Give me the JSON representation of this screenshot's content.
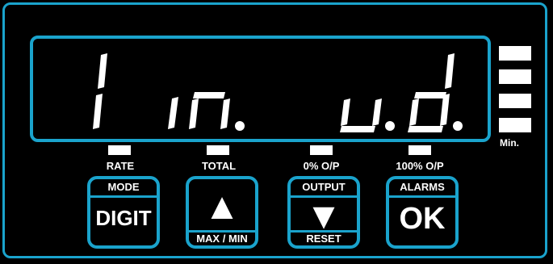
{
  "display": {
    "text": "1 in. u.d.",
    "level_bars": 4,
    "level_label": "Min."
  },
  "indicators": [
    {
      "label": "RATE"
    },
    {
      "label": "TOTAL"
    },
    {
      "label": "0% O/P"
    },
    {
      "label": "100% O/P"
    }
  ],
  "keys": {
    "mode": {
      "top": "MODE",
      "main": "DIGIT"
    },
    "up": {
      "main": "▲",
      "bottom": "MAX / MIN"
    },
    "output": {
      "top": "OUTPUT",
      "main": "▼",
      "bottom": "RESET"
    },
    "ok": {
      "top": "ALARMS",
      "main": "OK"
    }
  },
  "colors": {
    "accent": "#1aa3cc",
    "background": "#000000",
    "foreground": "#ffffff"
  }
}
